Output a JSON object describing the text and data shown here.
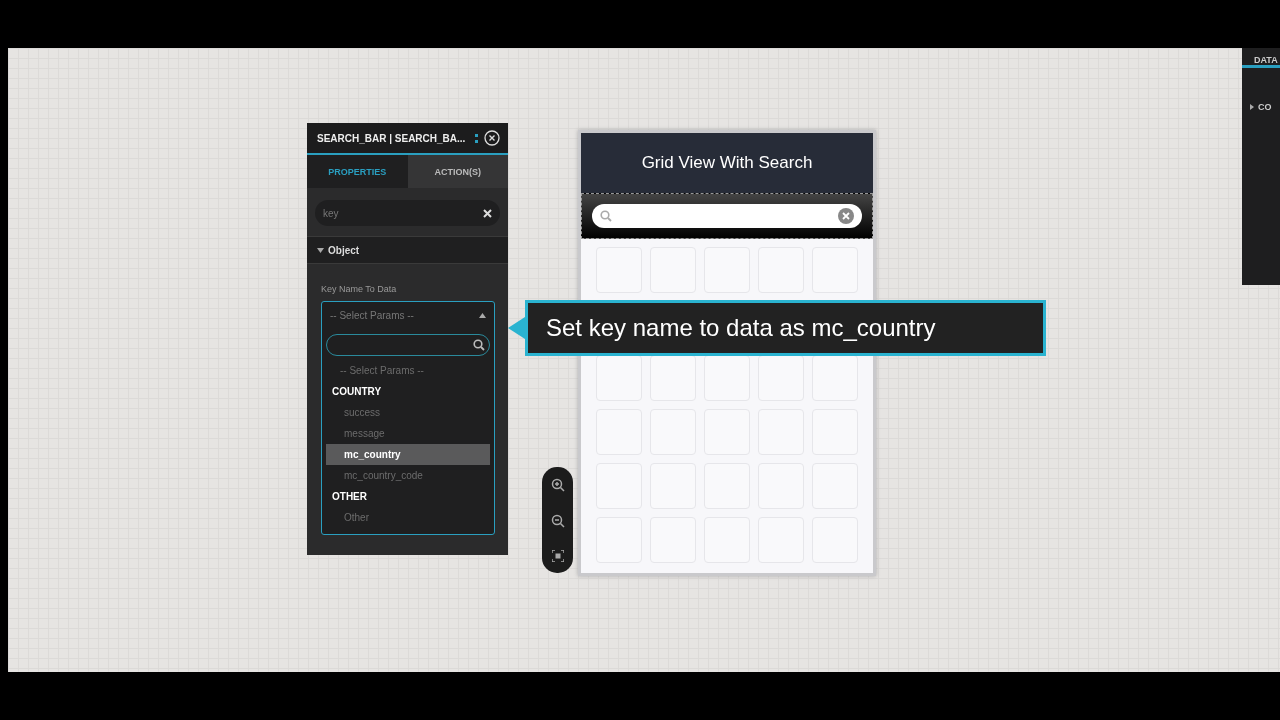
{
  "inspector": {
    "title": "SEARCH_BAR | SEARCH_BA...",
    "tabs": [
      {
        "label": "PROPERTIES",
        "selected": true
      },
      {
        "label": "ACTION(S)",
        "selected": false
      }
    ],
    "filter": {
      "value": "key"
    },
    "section": {
      "label": "Object",
      "expanded": true
    },
    "field_label": "Key Name To Data",
    "dropdown": {
      "value": "-- Select Params --",
      "expanded": true,
      "options": [
        {
          "kind": "placeholder",
          "label": "-- Select Params --"
        },
        {
          "kind": "group",
          "label": "COUNTRY"
        },
        {
          "kind": "option",
          "label": "success",
          "selected": false
        },
        {
          "kind": "option",
          "label": "message",
          "selected": false
        },
        {
          "kind": "option",
          "label": "mc_country",
          "selected": true
        },
        {
          "kind": "option",
          "label": "mc_country_code",
          "selected": false
        },
        {
          "kind": "group",
          "label": "OTHER"
        },
        {
          "kind": "option",
          "label": "Other",
          "selected": false
        }
      ]
    }
  },
  "preview": {
    "title": "Grid View With Search"
  },
  "tooltip": {
    "text": "Set key name to data as mc_country"
  },
  "side_panel": {
    "title": "DATA",
    "item": "CO"
  }
}
